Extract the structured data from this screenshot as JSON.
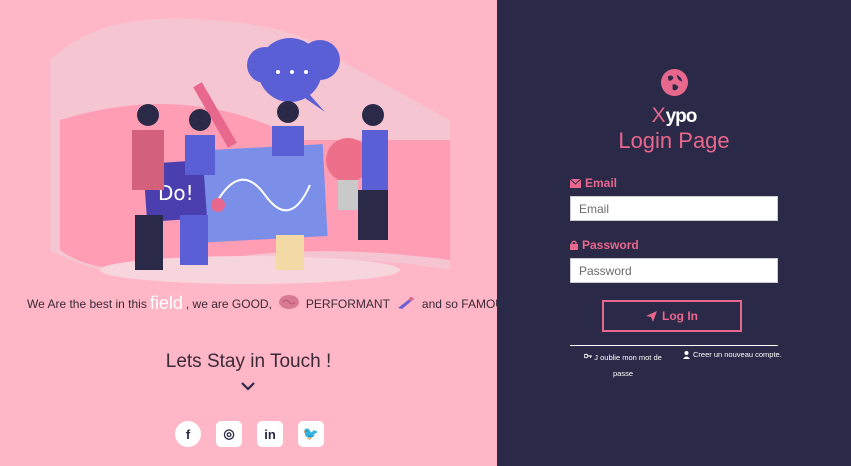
{
  "left_panel": {
    "tagline": {
      "part1": "We Are the best in this",
      "highlight": "field",
      "part2": ", we are GOOD,",
      "part3": "PERFORMANT",
      "part4": "and so FAMOUS",
      "part5": "."
    },
    "stay_in_touch": "Lets Stay in Touch !",
    "illustration_text": "Do!",
    "socials": [
      {
        "name": "facebook",
        "glyph": "f"
      },
      {
        "name": "instagram",
        "glyph": "◎"
      },
      {
        "name": "linkedin",
        "glyph": "in"
      },
      {
        "name": "twitter",
        "glyph": "🐦"
      }
    ]
  },
  "right_panel": {
    "brand_x": "X",
    "brand_ypo": "ypo",
    "title": "Login Page",
    "email_label": "Email",
    "email_placeholder": "Email",
    "password_label": "Password",
    "password_placeholder": "Password",
    "login_button": "Log In",
    "forgot_link": "J oublie mon mot de passe",
    "create_link": "Creer un nouveau compte."
  },
  "colors": {
    "left_bg": "#ffb6c6",
    "right_bg": "#2a2a48",
    "accent": "#e8678c"
  }
}
